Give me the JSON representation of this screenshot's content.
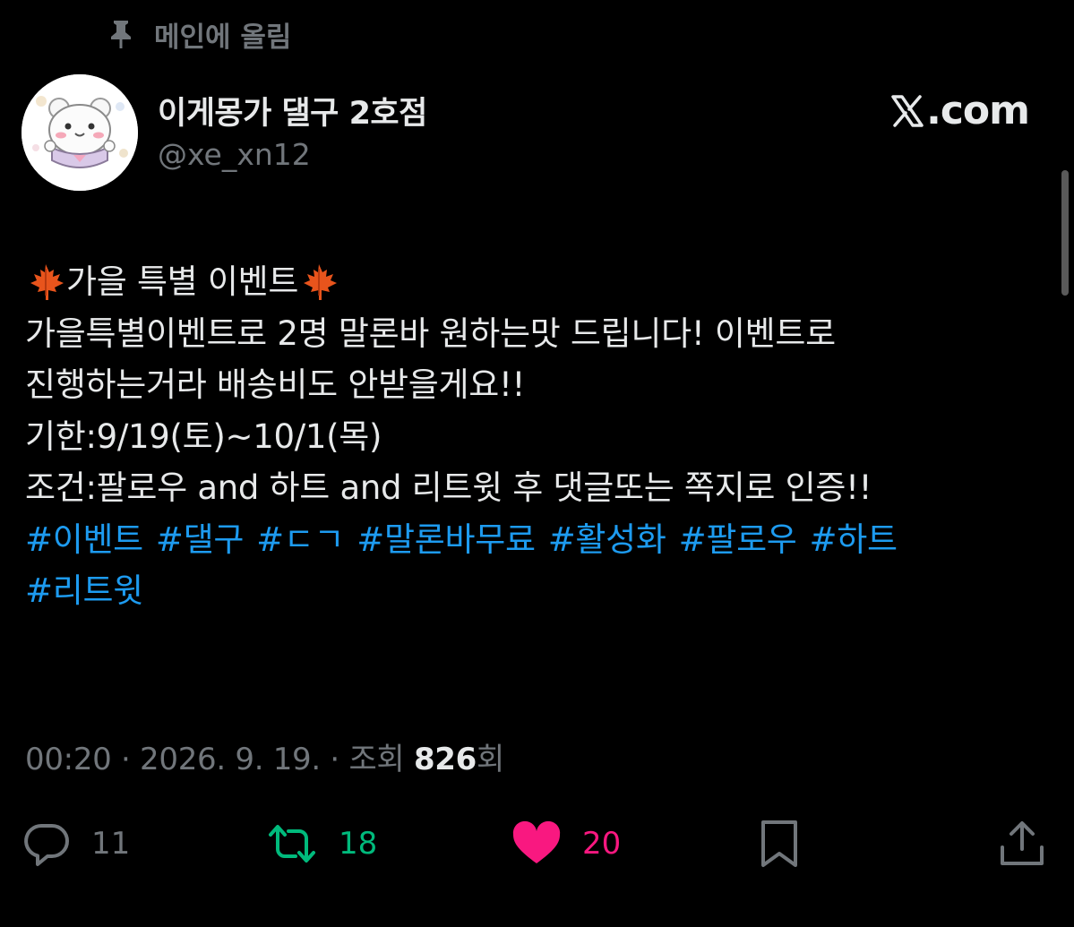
{
  "pinned": {
    "label": "메인에 올림",
    "icon": "pin-icon"
  },
  "author": {
    "display_name": "이게몽가 댈구 2호점",
    "handle": "@xe_xn12",
    "avatar": "hamster-avatar"
  },
  "brand": {
    "text": ".com",
    "logo": "x-logo-icon"
  },
  "tweet": {
    "title_text": "가을 특별 이벤트",
    "title_emoji": "maple-leaf-icon",
    "lines": [
      "가을특별이벤트로 2명 말론바 원하는맛 드립니다! 이벤트로",
      "진행하는거라 배송비도 안받을게요!!",
      "기한:9/19(토)~10/1(목)",
      "조건:팔로우 and 하트 and 리트윗 후 댓글또는 쪽지로 인증!!"
    ],
    "hashtags": [
      "#이벤트",
      "#댈구",
      "#ㄷㄱ",
      "#말론바무료",
      "#활성화",
      "#팔로우",
      "#하트",
      "#리트윗"
    ]
  },
  "meta": {
    "time": "00:20",
    "separator": "·",
    "date": "2026. 9. 19.",
    "views_label": "조회",
    "views_count": "826",
    "views_suffix": "회"
  },
  "actions": {
    "reply_count": "11",
    "retweet_count": "18",
    "like_count": "20"
  },
  "colors": {
    "background": "#000000",
    "text": "#e7e9ea",
    "muted": "#71767b",
    "link": "#1d9bf0",
    "retweet": "#00ba7c",
    "like": "#f91880"
  }
}
